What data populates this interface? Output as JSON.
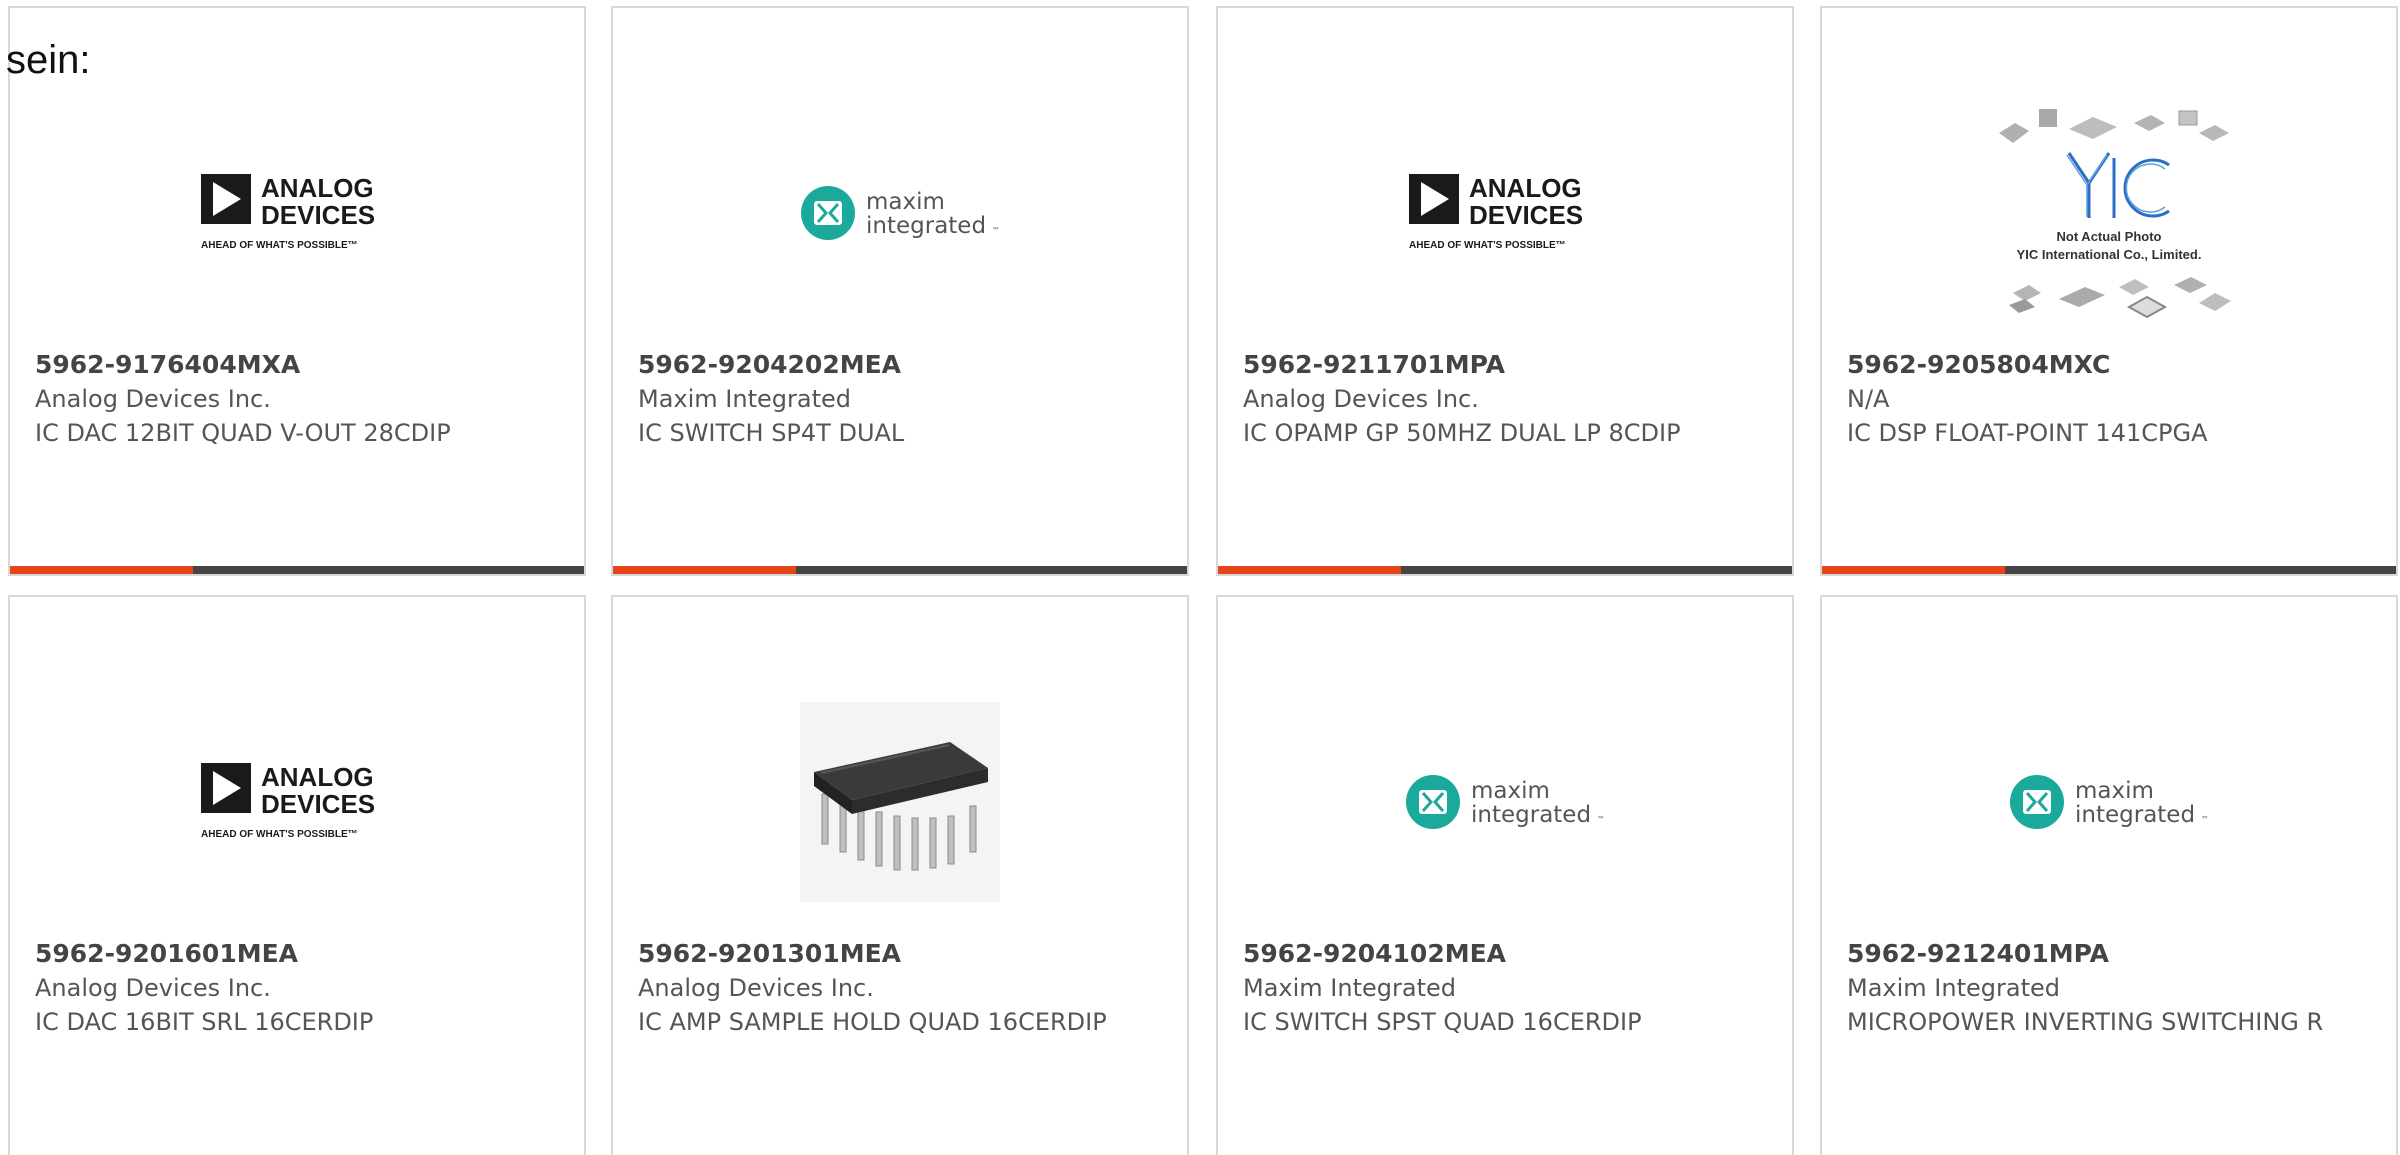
{
  "heading": "sein:",
  "colors": {
    "accent": "#e8441a",
    "bar": "#444444",
    "border": "#d8d8d8",
    "maxim_teal": "#1aa99a"
  },
  "logos": {
    "analog": {
      "line1": "ANALOG",
      "line2": "DEVICES",
      "tagline": "AHEAD OF WHAT'S POSSIBLE™"
    },
    "maxim": {
      "line1": "maxim",
      "line2": "integrated",
      "tm": "™"
    },
    "yic": {
      "brand": "YIC",
      "line1": "Not Actual Photo",
      "line2": "YIC International Co., Limited."
    }
  },
  "products": [
    {
      "part": "5962-9176404MXA",
      "maker": "Analog Devices Inc.",
      "desc": "IC DAC 12BIT QUAD V-OUT 28CDIP",
      "image": "analog-devices-logo"
    },
    {
      "part": "5962-9204202MEA",
      "maker": "Maxim Integrated",
      "desc": "IC SWITCH SP4T DUAL",
      "image": "maxim-integrated-logo"
    },
    {
      "part": "5962-9211701MPA",
      "maker": "Analog Devices Inc.",
      "desc": "IC OPAMP GP 50MHZ DUAL LP 8CDIP",
      "image": "analog-devices-logo"
    },
    {
      "part": "5962-9205804MXC",
      "maker": "N/A",
      "desc": "IC DSP FLOAT-POINT 141CPGA",
      "image": "yic-placeholder"
    },
    {
      "part": "5962-9201601MEA",
      "maker": "Analog Devices Inc.",
      "desc": "IC DAC 16BIT SRL 16CERDIP",
      "image": "analog-devices-logo"
    },
    {
      "part": "5962-9201301MEA",
      "maker": "Analog Devices Inc.",
      "desc": "IC AMP SAMPLE HOLD QUAD 16CERDIP",
      "image": "dip-chip-photo"
    },
    {
      "part": "5962-9204102MEA",
      "maker": "Maxim Integrated",
      "desc": "IC SWITCH SPST QUAD 16CERDIP",
      "image": "maxim-integrated-logo"
    },
    {
      "part": "5962-9212401MPA",
      "maker": "Maxim Integrated",
      "desc": "MICROPOWER INVERTING SWITCHING R",
      "image": "maxim-integrated-logo"
    }
  ]
}
